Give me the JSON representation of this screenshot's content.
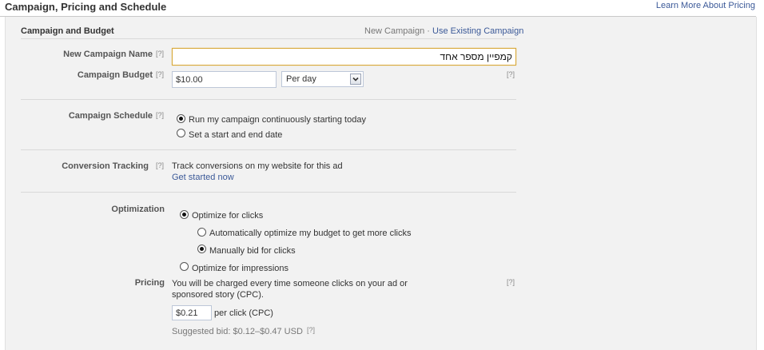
{
  "header": {
    "title": "Campaign, Pricing and Schedule",
    "learn_more_link": "Learn More About Pricing"
  },
  "campaign_budget": {
    "section_title": "Campaign and Budget",
    "new_campaign": "New Campaign",
    "separator": "·",
    "use_existing": "Use Existing Campaign",
    "name_label": "New Campaign Name",
    "name_value": "קמפיין מספר אחד",
    "budget_label": "Campaign Budget",
    "budget_value": "$10.00",
    "budget_period": "Per day",
    "help": "[?]"
  },
  "schedule": {
    "label": "Campaign Schedule",
    "options": [
      "Run my campaign continuously starting today",
      "Set a start and end date"
    ],
    "selected_index": 0
  },
  "conversion": {
    "label": "Conversion Tracking",
    "text": "Track conversions on my website for this ad",
    "link": "Get started now"
  },
  "optimization": {
    "label": "Optimization",
    "clicks": "Optimize for clicks",
    "auto": "Automatically optimize my budget to get more clicks",
    "manual": "Manually bid for clicks",
    "impressions": "Optimize for impressions",
    "selected": "clicks",
    "sub_selected": "manual"
  },
  "pricing": {
    "label": "Pricing",
    "description": "You will be charged every time someone clicks on your ad or sponsored story (CPC).",
    "bid_value": "$0.21",
    "bid_unit": "per click (CPC)",
    "suggested": "Suggested bid: $0.12–$0.47 USD"
  }
}
